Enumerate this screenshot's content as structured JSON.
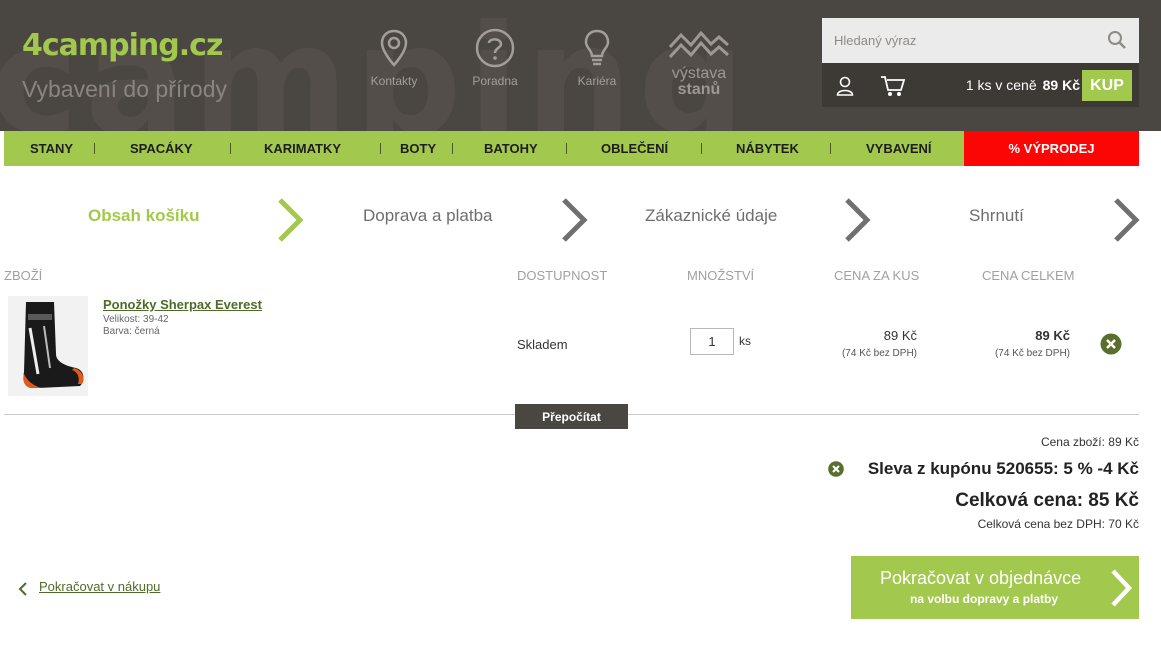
{
  "header": {
    "bg_text": "camping",
    "logo": {
      "num": "4",
      "name": "camping",
      "tld": ".cz"
    },
    "tagline": "Vybavení do přírody",
    "nav": [
      {
        "label": "Kontakty",
        "icon": "map-pin-icon"
      },
      {
        "label": "Poradna",
        "icon": "question-icon"
      },
      {
        "label": "Kariéra",
        "icon": "lightbulb-icon"
      }
    ],
    "vystava": {
      "line1": "výstava",
      "line2": "stanů"
    },
    "search": {
      "placeholder": "Hledaný výraz",
      "value": ""
    },
    "cart": {
      "text": "1 ks v ceně",
      "price": "89 Kč",
      "buy_label": "KUP"
    }
  },
  "categories": [
    "STANY",
    "SPACÁKY",
    "KARIMATKY",
    "BOTY",
    "BATOHY",
    "OBLEČENÍ",
    "NÁBYTEK",
    "VYBAVENÍ"
  ],
  "sale_label": "% VÝPRODEJ",
  "steps": [
    {
      "label": "Obsah košíku",
      "active": true
    },
    {
      "label": "Doprava a platba",
      "active": false
    },
    {
      "label": "Zákaznické údaje",
      "active": false
    },
    {
      "label": "Shrnutí",
      "active": false
    }
  ],
  "table": {
    "headers": {
      "item": "ZBOŽÍ",
      "availability": "DOSTUPNOST",
      "quantity": "MNOŽSTVÍ",
      "unit_price": "CENA ZA KUS",
      "total_price": "CENA CELKEM"
    },
    "items": [
      {
        "name": "Ponožky Sherpax Everest",
        "size": "Velikost: 39-42",
        "color": "Barva: černá",
        "availability": "Skladem",
        "quantity": "1",
        "unit": "ks",
        "unit_price": "89 Kč",
        "unit_price_nodph": "(74 Kč bez DPH)",
        "total_price": "89 Kč",
        "total_price_nodph": "(74 Kč bez DPH)"
      }
    ]
  },
  "recalc_label": "Přepočítat",
  "summary": {
    "subtotal": "Cena zboží: 89 Kč",
    "coupon": "Sleva z kupónu 520655: 5 % -4 Kč",
    "total": "Celková cena: 85 Kč",
    "total_nodph": "Celková cena bez DPH: 70 Kč"
  },
  "back_link": "Pokračovat v nákupu",
  "continue": {
    "main": "Pokračovat v objednávce",
    "sub": "na volbu dopravy a platby"
  },
  "colors": {
    "brand_green": "#a2c94e",
    "header_bg": "#4a4642",
    "sale_red": "#fb0505",
    "link_green": "#4f6b2a"
  }
}
